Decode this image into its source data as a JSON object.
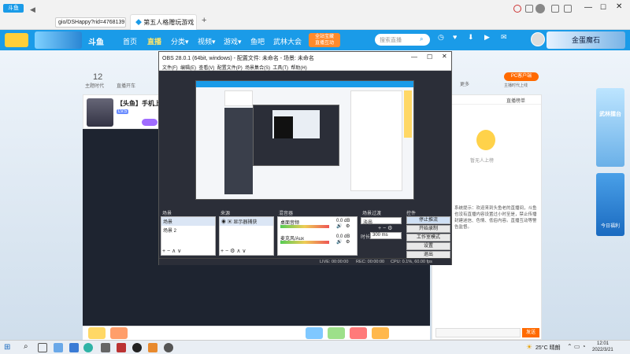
{
  "browser": {
    "address": "gio/DSHappy?rid=4768139",
    "tab_title": "第五人格赠玩游戏",
    "new_tab": "+",
    "logo": "斗鱼"
  },
  "site": {
    "nav": [
      "首页",
      "直播",
      "分类▾",
      "视频▾",
      "游戏▾",
      "鱼吧",
      "武林大会"
    ],
    "promo": "全站宝藏\n直播互动",
    "search_placeholder": "搜索直播",
    "user_icons": [
      "历史",
      "关注",
      "下载",
      "开播",
      "消息"
    ],
    "banner": "金蛋魔石"
  },
  "page": {
    "count": "12",
    "count_label": "主题时代",
    "count2_label": "直播开车",
    "streamer_title": "【头鱼】手机上",
    "tag": "LV.5",
    "right_promo": "PC客户端",
    "right_label": "主播时代上线",
    "more": "更多",
    "chat_title": "直播榜单",
    "chat_sub": "暂无人上榜",
    "chat_text": "系统提示：欢迎来到头鱼老的直播间，斗鱼也没有直播内容设置过小时至是，禁止传播封建迷信、色情、低俗内容。直播互动等警告监督。",
    "chat_send": "发送",
    "sidebar_banner": "武林擂台",
    "sidebar_banner2": "今日福利"
  },
  "obs": {
    "title": "OBS 28.0.1 (64bit, windows) - 配置文件: 未命名 - 场景: 未命名",
    "menu": [
      "文件(F)",
      "编辑(E)",
      "查看(V)",
      "配置文件(P)",
      "场景集合(S)",
      "工具(T)",
      "帮助(H)"
    ],
    "panels": {
      "scenes": "场景",
      "sources": "来源",
      "mixer": "混音器",
      "transitions": "场景过渡",
      "controls": "控件"
    },
    "scene_items": [
      "场景",
      "场景 2"
    ],
    "source_item": "显示器捕获",
    "mixer_items": [
      {
        "name": "桌面音频",
        "db": "0.0 dB"
      },
      {
        "name": "麦克风/Aux",
        "db": "0.0 dB"
      }
    ],
    "transition": "淡出",
    "duration_label": "时长",
    "duration": "300 ms",
    "controls": [
      "停止推流",
      "开始录制",
      "工作室模式",
      "设置",
      "退出"
    ],
    "status": {
      "live": "LIVE: 00:00:00",
      "rec": "REC: 00:00:00",
      "cpu": "CPU: 0.1%, 60.00 fps"
    }
  },
  "taskbar": {
    "weather": "25°C 晴朗",
    "time": "12:01",
    "date": "2022/3/21"
  },
  "colors": {
    "brand": "#1a9be8",
    "accent": "#ff6a00",
    "obs_bg": "#2b2e38"
  }
}
